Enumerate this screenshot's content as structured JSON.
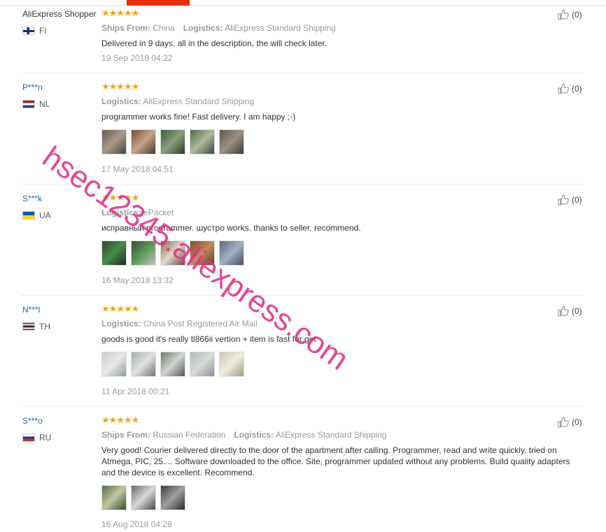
{
  "labels": {
    "ships_from": "Ships From:",
    "logistics": "Logistics:"
  },
  "watermark": "hsec12345.aliexpress.com",
  "star_color": "#f6a20f",
  "accent_color": "#e62e04",
  "reviews": [
    {
      "user": "AliExpress Shopper",
      "country": "FI",
      "rating": 5,
      "ships_from": "China",
      "logistics": "AliExpress Standard Shipping",
      "text": "Delivered in 9 days, all in the description, the will check later.",
      "date": "19 Sep 2018 04:22",
      "helpful": "(0)"
    },
    {
      "user": "P***n",
      "country": "NL",
      "rating": 5,
      "logistics": "AliExpress Standard Shipping",
      "text": "programmer works fine! Fast delivery. I am happy ;-)",
      "date": "17 May 2018 04:51",
      "helpful": "(0)",
      "photo_count": 5
    },
    {
      "user": "S***k",
      "country": "UA",
      "rating": 5,
      "logistics": "ePacket",
      "text": "исправный programmer. шустро works. thanks to seller. recommend.",
      "date": "16 May 2018 13:32",
      "helpful": "(0)",
      "photo_count": 5
    },
    {
      "user": "N***l",
      "country": "TH",
      "rating": 5,
      "logistics": "China Post Registered Air Mail",
      "text": "goods is good it's really tl866ii vertion + item is fast for get",
      "date": "11 Apr 2018 00:21",
      "helpful": "(0)",
      "photo_count": 5
    },
    {
      "user": "S***o",
      "country": "RU",
      "rating": 5,
      "ships_from": "Russian Federation",
      "logistics": "AliExpress Standard Shipping",
      "text": "Very good! Courier delivered directly to the door of the apartment after calling. Programmer, read and write quickly, tried on Atmega, PIC, 25.... Software downloaded to the office. Site, programmer updated without any problems. Build quality adapters and the device is excellent. Recommend.",
      "date": "16 Aug 2018 04:28",
      "helpful": "(0)",
      "photo_count": 3
    }
  ]
}
